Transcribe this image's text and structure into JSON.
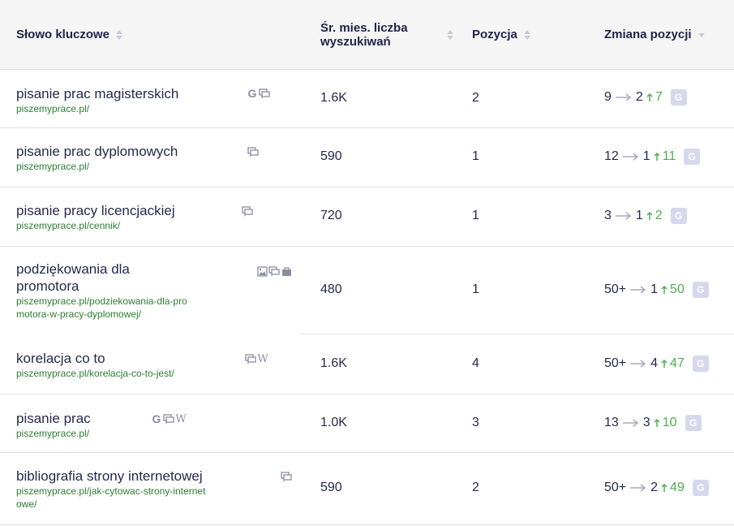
{
  "header": {
    "keyword": "Słowo kluczowe",
    "volume_line1": "Śr. mies. liczba",
    "volume_line2": "wyszukiwań",
    "position": "Pozycja",
    "change": "Zmiana pozycji"
  },
  "rows": [
    {
      "keyword": "pisanie prac magisterskich",
      "url": "piszemyprace.pl/",
      "volume": "1.6K",
      "position": "2",
      "from": "9",
      "to": "2",
      "gain": "7",
      "serp": [
        "G",
        "reviews"
      ]
    },
    {
      "keyword": "pisanie prac dyplomowych",
      "url": "piszemyprace.pl/",
      "volume": "590",
      "position": "1",
      "from": "12",
      "to": "1",
      "gain": "11",
      "serp": [
        "reviews"
      ]
    },
    {
      "keyword": "pisanie pracy licencjackiej",
      "url": "piszemyprace.pl/cennik/",
      "volume": "720",
      "position": "1",
      "from": "3",
      "to": "1",
      "gain": "2",
      "serp": [
        "reviews"
      ]
    },
    {
      "keyword_line1": "podziękowania dla",
      "keyword_line2": "promotora",
      "url_line1": "piszemyprace.pl/podziekowania-dla-pro",
      "url_line2": "motora-w-pracy-dyplomowej/",
      "volume": "480",
      "position": "1",
      "from": "50+",
      "to": "1",
      "gain": "50",
      "serp": [
        "image",
        "reviews",
        "ads"
      ]
    },
    {
      "keyword": "korelacja co to",
      "url": "piszemyprace.pl/korelacja-co-to-jest/",
      "volume": "1.6K",
      "position": "4",
      "from": "50+",
      "to": "4",
      "gain": "47",
      "serp": [
        "reviews",
        "W"
      ]
    },
    {
      "keyword": "pisanie prac",
      "url": "piszemyprace.pl/",
      "volume": "1.0K",
      "position": "3",
      "from": "13",
      "to": "3",
      "gain": "10",
      "serp": [
        "G",
        "reviews",
        "W"
      ]
    },
    {
      "keyword": "bibliografia strony internetowej",
      "url_line1": "piszemyprace.pl/jak-cytowac-strony-internet",
      "url_line2": "owe/",
      "volume": "590",
      "position": "2",
      "from": "50+",
      "to": "2",
      "gain": "49",
      "serp": [
        "reviews"
      ]
    }
  ],
  "badge_letter": "G",
  "icons": {
    "serp_google": "G",
    "serp_reviews": "reviews-icon",
    "serp_wiki": "W",
    "serp_image": "image-icon",
    "serp_ads": "ads-icon"
  },
  "colors": {
    "header_bg": "#f5f5f6",
    "text": "#252a4d",
    "url": "#2e7d32",
    "gain": "#4caf50",
    "badge": "#d6d8eb"
  }
}
